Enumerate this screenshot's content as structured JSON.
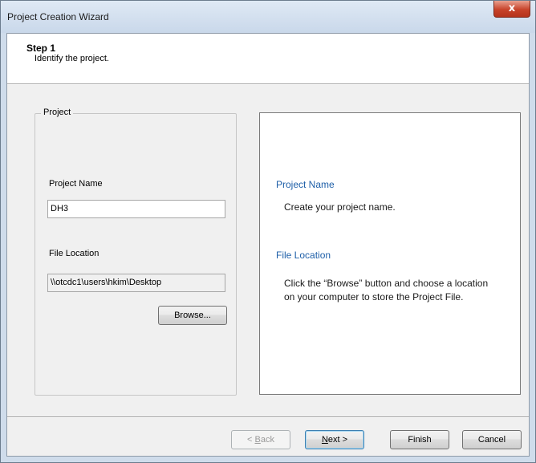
{
  "window": {
    "title": "Project Creation Wizard",
    "close_glyph": "x"
  },
  "header": {
    "step_title": "Step 1",
    "step_subtitle": "Identify the project."
  },
  "project_group": {
    "label": "Project",
    "project_name_label": "Project Name",
    "project_name_value": "DH3",
    "file_location_label": "File Location",
    "file_location_value": "\\\\otcdc1\\users\\hkim\\Desktop",
    "browse_label": "Browse..."
  },
  "info": {
    "project_name_heading": "Project Name",
    "project_name_text": "Create your project name.",
    "file_location_heading": "File Location",
    "file_location_text": "Click the “Browse” button and choose a location on your computer to store the Project File."
  },
  "footer": {
    "back_prefix": "< ",
    "back_accel": "B",
    "back_rest": "ack",
    "next_accel": "N",
    "next_rest": "ext >",
    "finish_label": "Finish",
    "cancel_label": "Cancel"
  }
}
